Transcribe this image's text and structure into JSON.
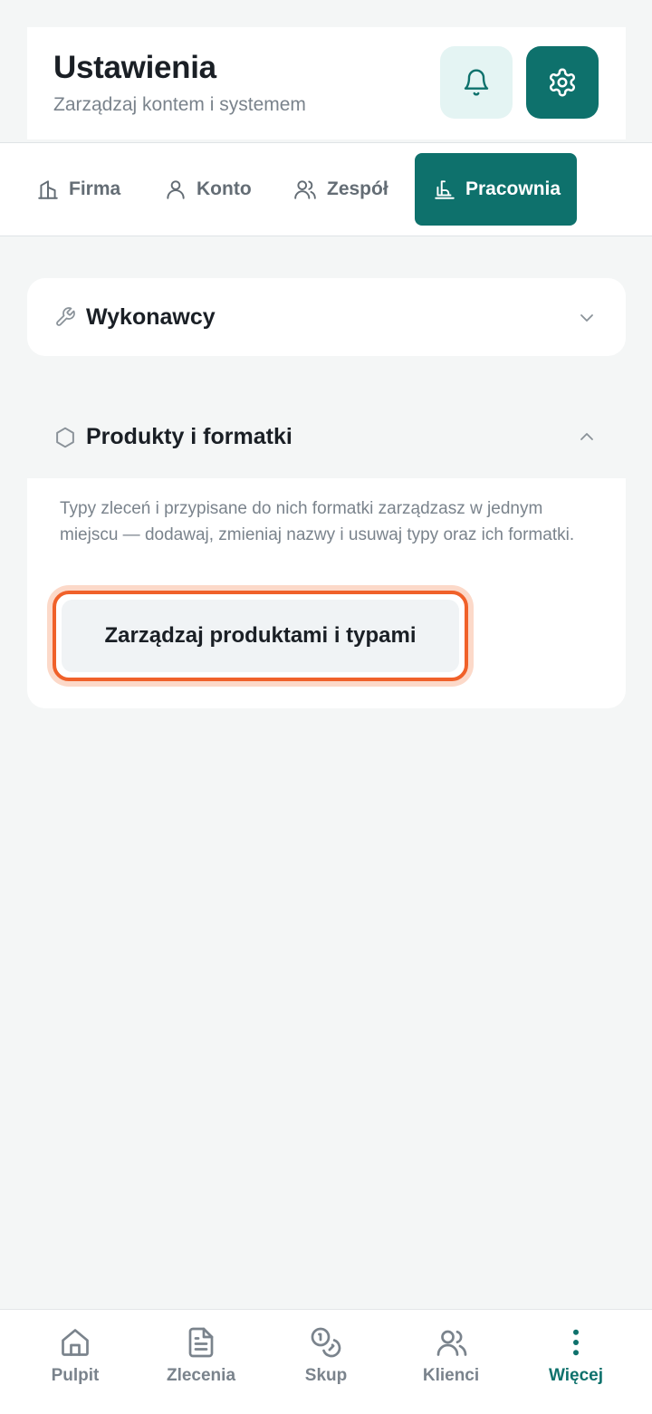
{
  "header": {
    "title": "Ustawienia",
    "subtitle": "Zarządzaj kontem i systemem",
    "bell_icon": "bell-icon",
    "settings_icon": "gear-icon"
  },
  "tabs": [
    {
      "label": "Firma",
      "icon": "building-icon"
    },
    {
      "label": "Konto",
      "icon": "user-icon"
    },
    {
      "label": "Zespół",
      "icon": "users-icon"
    },
    {
      "label": "Pracownia",
      "icon": "workshop-icon",
      "active": true
    }
  ],
  "sections": {
    "contractors": {
      "title": "Wykonawcy",
      "icon": "wrench-icon",
      "expanded": false
    },
    "products": {
      "title": "Produkty i formatki",
      "icon": "hexagon-icon",
      "expanded": true,
      "description": "Typy zleceń i przypisane do nich formatki zarządzasz w jednym miejscu — dodawaj, zmieniaj nazwy i usuwaj typy oraz ich formatki.",
      "button_label": "Zarządzaj produktami i typami"
    }
  },
  "bottom_nav": [
    {
      "label": "Pulpit",
      "icon": "home-icon"
    },
    {
      "label": "Zlecenia",
      "icon": "document-icon"
    },
    {
      "label": "Skup",
      "icon": "coins-icon"
    },
    {
      "label": "Klienci",
      "icon": "users-icon"
    },
    {
      "label": "Więcej",
      "icon": "more-vertical-icon",
      "active": true
    }
  ],
  "colors": {
    "accent": "#0e716c",
    "highlight": "#f0612a",
    "background": "#f4f6f6"
  }
}
